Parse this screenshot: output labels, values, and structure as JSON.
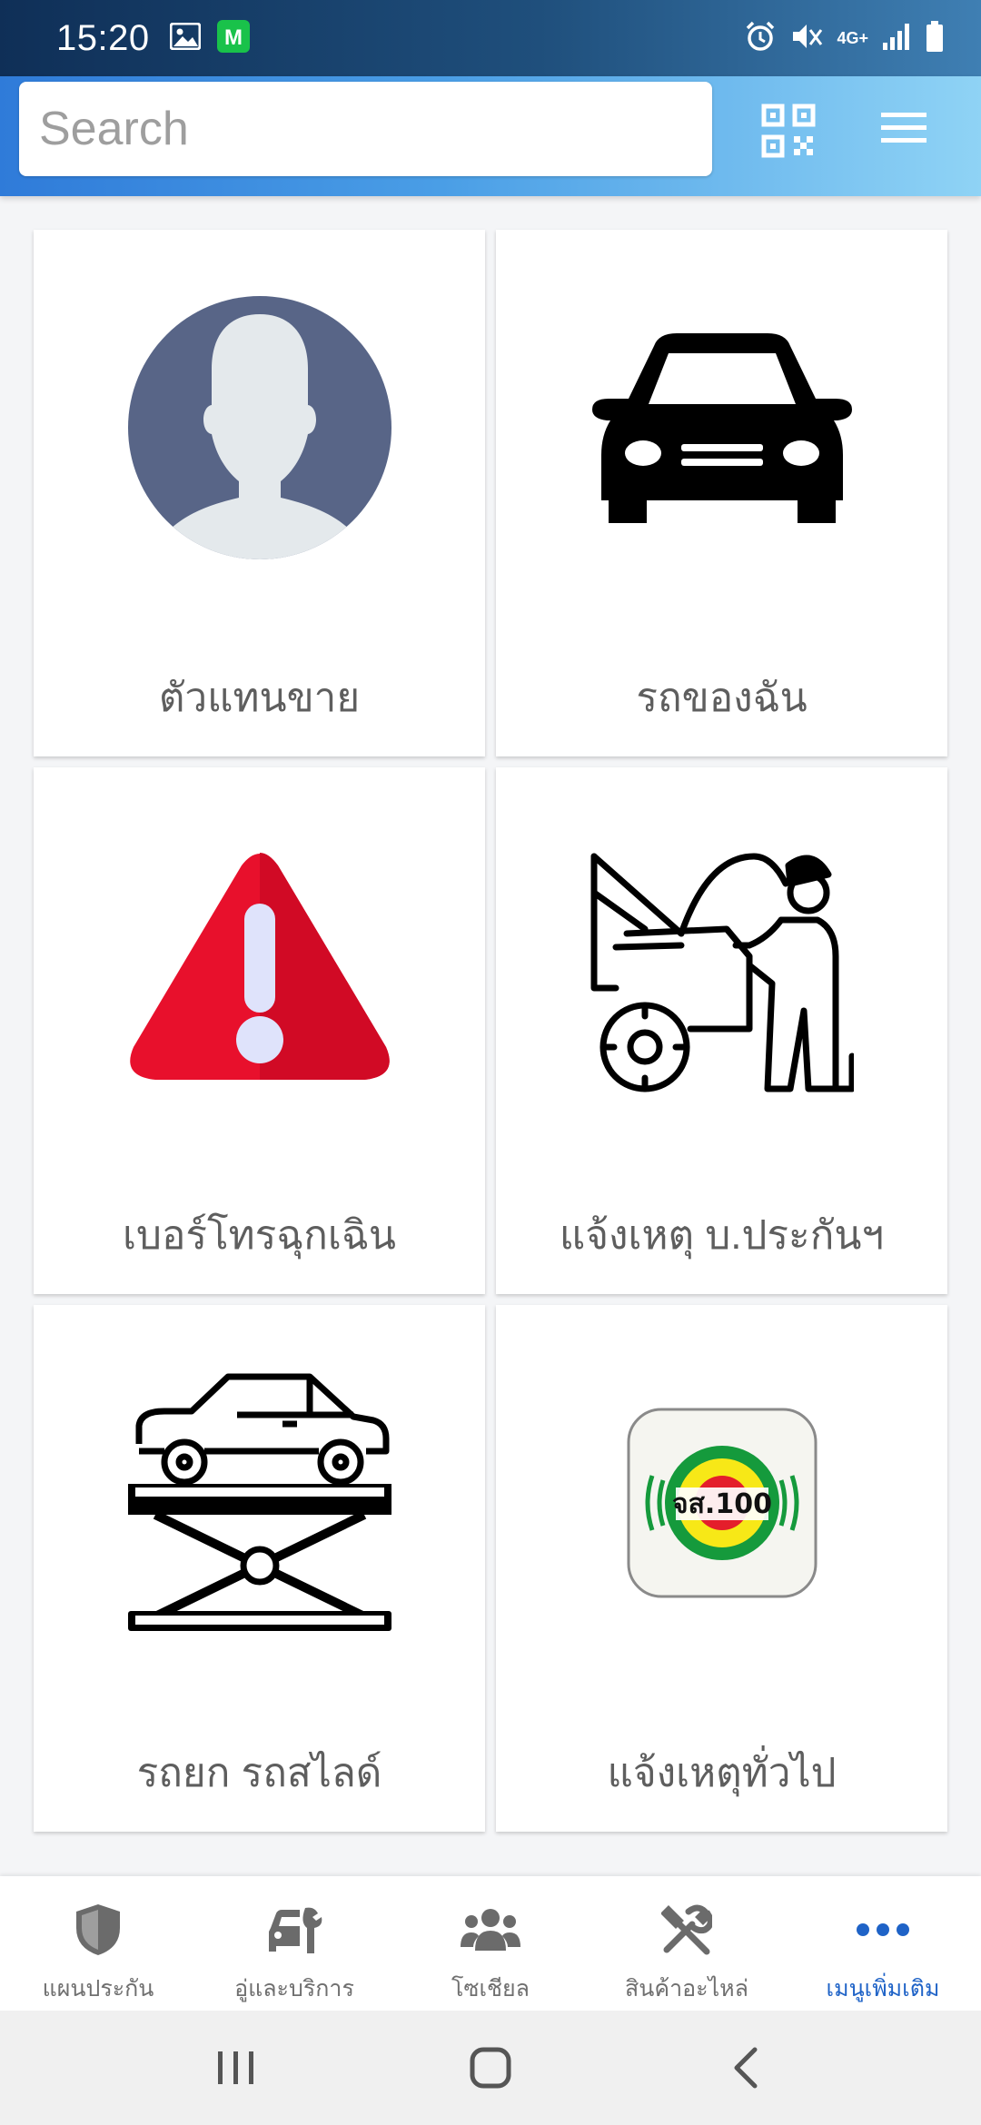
{
  "status_bar": {
    "time": "15:20",
    "left_icons": [
      "image-icon",
      "line-m-icon"
    ],
    "right_icons": [
      "alarm-icon",
      "mute-icon",
      "network-4g-icon",
      "signal-icon",
      "battery-icon"
    ],
    "network_label": "4G+"
  },
  "header": {
    "search_placeholder": "Search",
    "qr_icon": "qr-code-icon",
    "menu_icon": "hamburger-menu-icon",
    "accent_color": "#3a8fe0"
  },
  "cards": [
    {
      "label": "ตัวแทนขาย",
      "icon": "agent-avatar-icon"
    },
    {
      "label": "รถของฉัน",
      "icon": "car-icon"
    },
    {
      "label": "เบอร์โทรฉุกเฉิน",
      "icon": "warning-icon"
    },
    {
      "label": "แจ้งเหตุ บ.ประกันฯ",
      "icon": "mechanic-icon"
    },
    {
      "label": "รถยก รถสไลด์",
      "icon": "car-lift-icon"
    },
    {
      "label": "แจ้งเหตุทั่วไป",
      "icon": "jsor100-logo-icon"
    }
  ],
  "logo_text": "จส.100",
  "bottom_nav": {
    "items": [
      {
        "label": "แผนประกัน",
        "icon": "shield-icon"
      },
      {
        "label": "อู่และบริการ",
        "icon": "car-repair-icon"
      },
      {
        "label": "โซเชียล",
        "icon": "users-icon"
      },
      {
        "label": "สินค้าอะไหล่",
        "icon": "tools-icon"
      },
      {
        "label": "เมนูเพิ่มเติม",
        "icon": "more-dots-icon"
      }
    ],
    "active_index": 4,
    "active_color": "#1f63c7"
  },
  "system_nav": [
    "recents-icon",
    "home-icon",
    "back-icon"
  ]
}
